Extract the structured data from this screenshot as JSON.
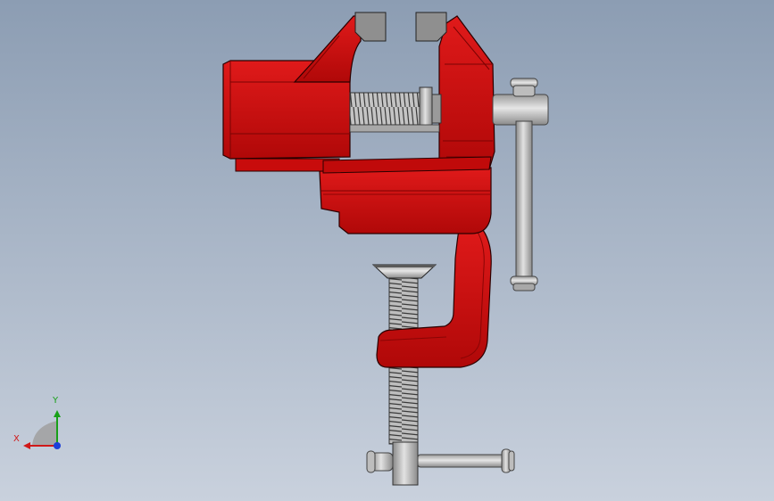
{
  "viewport": {
    "background_top": "#8c9db3",
    "background_bottom": "#c9d1dd"
  },
  "model": {
    "body_color": "#d30e0e",
    "body_dark": "#9a0606",
    "body_edge": "#2a0000",
    "metal_color": "#c9c9c9",
    "metal_dark": "#7a7a7a",
    "jaw_color": "#8f8f8f"
  },
  "triad": {
    "x_label": "X",
    "y_label": "Y",
    "x_color": "#d01818",
    "y_color": "#18a018",
    "z_color": "#1c3fd8"
  }
}
